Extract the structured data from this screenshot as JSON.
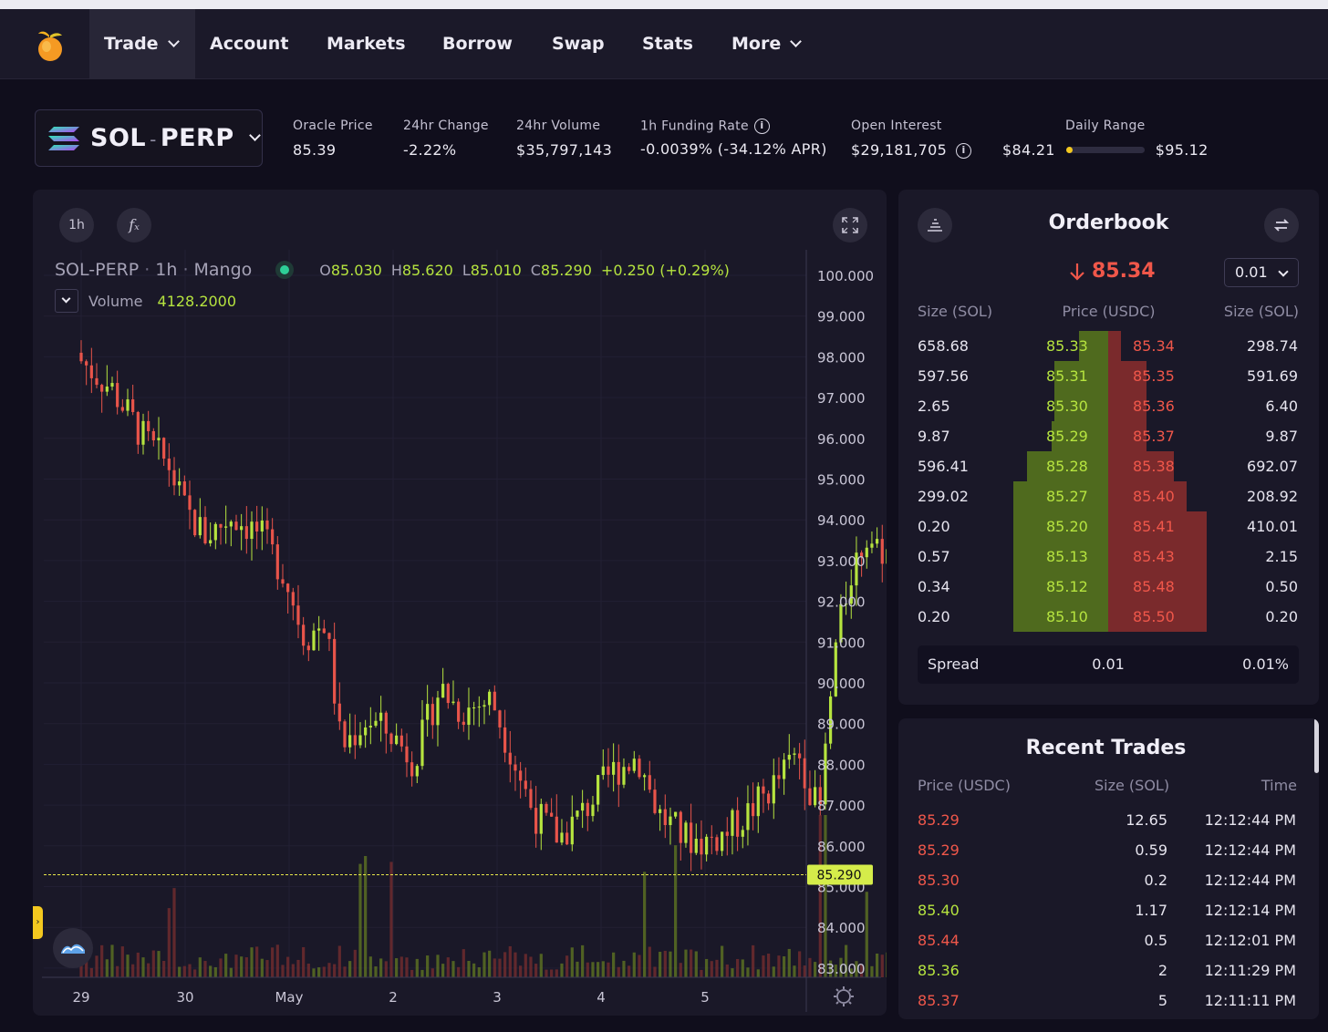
{
  "nav": {
    "items": [
      {
        "label": "Trade",
        "dropdown": true,
        "active": true
      },
      {
        "label": "Account"
      },
      {
        "label": "Markets"
      },
      {
        "label": "Borrow"
      },
      {
        "label": "Swap"
      },
      {
        "label": "Stats"
      },
      {
        "label": "More",
        "dropdown": true
      }
    ]
  },
  "market": {
    "name": "SOL-PERP",
    "base": "SOL",
    "quote": "PERP"
  },
  "stats": {
    "oracle_price_label": "Oracle Price",
    "oracle_price": "85.39",
    "change_label": "24hr Change",
    "change": "-2.22%",
    "volume_label": "24hr Volume",
    "volume": "$35,797,143",
    "funding_label": "1h Funding Rate",
    "funding": "-0.0039% (-34.12% APR)",
    "oi_label": "Open Interest",
    "oi": "$29,181,705",
    "range_label": "Daily Range",
    "range_low": "$84.21",
    "range_high": "$95.12",
    "range_fraction": 0.08
  },
  "chart": {
    "interval_btn": "1h",
    "fx_btn": "fₓ",
    "symbol": "SOL-PERP",
    "interval": "1h",
    "source": "Mango",
    "o_label": "O",
    "o": "85.030",
    "h_label": "H",
    "h": "85.620",
    "l_label": "L",
    "l": "85.010",
    "c_label": "C",
    "c": "85.290",
    "chg": "+0.250 (+0.29%)",
    "vol_label": "Volume",
    "vol": "4128.2000",
    "last_price_tag": "85.290",
    "colors": {
      "up": "#b6e43f",
      "down": "#e8544a",
      "bg": "#1a1828"
    }
  },
  "chart_data": {
    "type": "candlestick",
    "y_ticks": [
      "100.000",
      "99.000",
      "98.000",
      "97.000",
      "96.000",
      "95.000",
      "94.000",
      "93.000",
      "92.000",
      "91.000",
      "90.000",
      "89.000",
      "88.000",
      "87.000",
      "86.000",
      "85.000",
      "84.000",
      "83.000"
    ],
    "x_ticks": [
      "29",
      "30",
      "May",
      "2",
      "3",
      "4",
      "5"
    ],
    "ylim": [
      82.8,
      100.5
    ],
    "last_price": 85.29,
    "close_path": [
      {
        "day": 0.0,
        "close": 97.9
      },
      {
        "day": 0.3,
        "close": 97.2
      },
      {
        "day": 0.6,
        "close": 96.0
      },
      {
        "day": 0.85,
        "close": 95.3
      },
      {
        "day": 1.0,
        "close": 94.2
      },
      {
        "day": 1.2,
        "close": 93.6
      },
      {
        "day": 1.45,
        "close": 94.1
      },
      {
        "day": 1.7,
        "close": 93.7
      },
      {
        "day": 1.95,
        "close": 92.7
      },
      {
        "day": 2.15,
        "close": 91.1
      },
      {
        "day": 2.35,
        "close": 91.5
      },
      {
        "day": 2.5,
        "close": 88.4
      },
      {
        "day": 2.75,
        "close": 89.1
      },
      {
        "day": 3.0,
        "close": 88.7
      },
      {
        "day": 3.2,
        "close": 88.1
      },
      {
        "day": 3.45,
        "close": 89.9
      },
      {
        "day": 3.65,
        "close": 89.3
      },
      {
        "day": 3.95,
        "close": 89.6
      },
      {
        "day": 4.15,
        "close": 88.2
      },
      {
        "day": 4.35,
        "close": 86.8
      },
      {
        "day": 4.6,
        "close": 86.2
      },
      {
        "day": 4.85,
        "close": 86.9
      },
      {
        "day": 5.1,
        "close": 87.8
      },
      {
        "day": 5.35,
        "close": 88.2
      },
      {
        "day": 5.55,
        "close": 86.8
      },
      {
        "day": 5.8,
        "close": 86.2
      },
      {
        "day": 6.0,
        "close": 86.1
      },
      {
        "day": 6.2,
        "close": 86.3
      },
      {
        "day": 6.45,
        "close": 86.9
      },
      {
        "day": 6.7,
        "close": 87.6
      },
      {
        "day": 6.9,
        "close": 88.3
      },
      {
        "day": 7.1,
        "close": 86.7
      },
      {
        "day": 7.25,
        "close": 90.8
      },
      {
        "day": 7.4,
        "close": 92.7
      },
      {
        "day": 7.55,
        "close": 93.6
      },
      {
        "day": 7.75,
        "close": 93.2
      },
      {
        "day": 7.95,
        "close": 92.3
      },
      {
        "day": 8.05,
        "close": 91.6
      },
      {
        "day": 8.15,
        "close": 89.6
      },
      {
        "day": 8.25,
        "close": 86.0
      },
      {
        "day": 8.33,
        "close": 85.1
      },
      {
        "day": 8.4,
        "close": 85.29
      }
    ]
  },
  "orderbook": {
    "title": "Orderbook",
    "last_price": "85.34",
    "tick_size": "0.01",
    "headers": [
      "Size (SOL)",
      "Price (USDC)",
      "Size (SOL)"
    ],
    "bids": [
      {
        "size": "658.68",
        "price": "85.33",
        "depth": 0.19
      },
      {
        "size": "597.56",
        "price": "85.31",
        "depth": 0.35
      },
      {
        "size": "2.65",
        "price": "85.30",
        "depth": 0.35
      },
      {
        "size": "9.87",
        "price": "85.29",
        "depth": 0.37
      },
      {
        "size": "596.41",
        "price": "85.28",
        "depth": 0.53
      },
      {
        "size": "299.02",
        "price": "85.27",
        "depth": 0.62
      },
      {
        "size": "0.20",
        "price": "85.20",
        "depth": 0.62
      },
      {
        "size": "0.57",
        "price": "85.13",
        "depth": 0.62
      },
      {
        "size": "0.34",
        "price": "85.12",
        "depth": 0.62
      },
      {
        "size": "0.20",
        "price": "85.10",
        "depth": 0.62
      }
    ],
    "asks": [
      {
        "price": "85.34",
        "size": "298.74",
        "depth": 0.09
      },
      {
        "price": "85.35",
        "size": "591.69",
        "depth": 0.28
      },
      {
        "price": "85.36",
        "size": "6.40",
        "depth": 0.28
      },
      {
        "price": "85.37",
        "size": "9.87",
        "depth": 0.28
      },
      {
        "price": "85.38",
        "size": "692.07",
        "depth": 0.48
      },
      {
        "price": "85.40",
        "size": "208.92",
        "depth": 0.57
      },
      {
        "price": "85.41",
        "size": "410.01",
        "depth": 0.72
      },
      {
        "price": "85.43",
        "size": "2.15",
        "depth": 0.72
      },
      {
        "price": "85.48",
        "size": "0.50",
        "depth": 0.72
      },
      {
        "price": "85.50",
        "size": "0.20",
        "depth": 0.72
      }
    ],
    "spread_label": "Spread",
    "spread": "0.01",
    "spread_pct": "0.01%"
  },
  "recent_trades": {
    "title": "Recent Trades",
    "headers": [
      "Price (USDC)",
      "Size (SOL)",
      "Time"
    ],
    "rows": [
      {
        "price": "85.29",
        "size": "12.65",
        "time": "12:12:44 PM",
        "side": "sell"
      },
      {
        "price": "85.29",
        "size": "0.59",
        "time": "12:12:44 PM",
        "side": "sell"
      },
      {
        "price": "85.30",
        "size": "0.2",
        "time": "12:12:44 PM",
        "side": "sell"
      },
      {
        "price": "85.40",
        "size": "1.17",
        "time": "12:12:14 PM",
        "side": "buy"
      },
      {
        "price": "85.44",
        "size": "0.5",
        "time": "12:12:01 PM",
        "side": "sell"
      },
      {
        "price": "85.36",
        "size": "2",
        "time": "12:11:29 PM",
        "side": "buy"
      },
      {
        "price": "85.37",
        "size": "5",
        "time": "12:11:11 PM",
        "side": "sell"
      }
    ]
  }
}
